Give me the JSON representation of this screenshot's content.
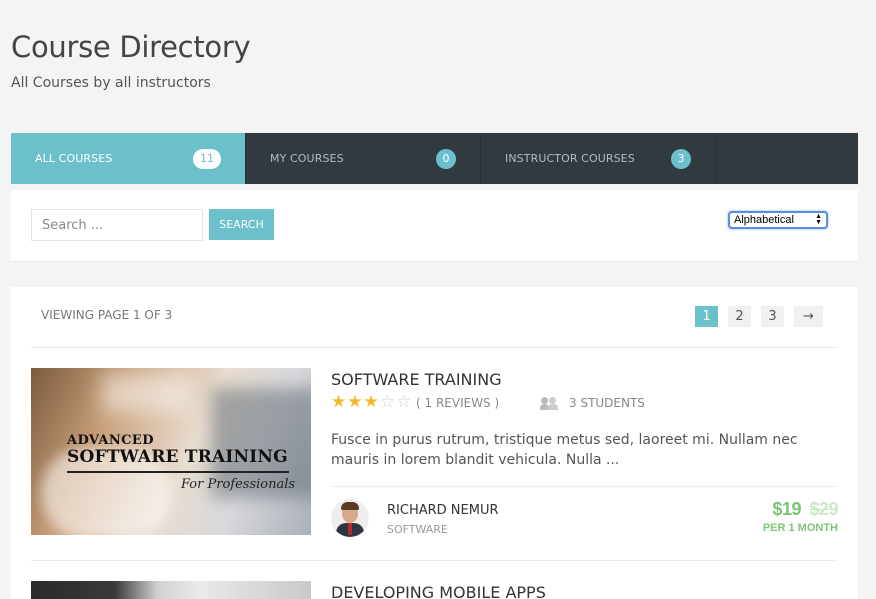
{
  "header": {
    "title": "Course Directory",
    "subtitle": "All Courses by all instructors"
  },
  "tabs": [
    {
      "label": "All Courses",
      "count": "11",
      "active": true
    },
    {
      "label": "My Courses",
      "count": "0",
      "active": false
    },
    {
      "label": "Instructor Courses",
      "count": "3",
      "active": false
    }
  ],
  "search": {
    "placeholder": "Search ...",
    "value": "",
    "button_label": "Search",
    "sort_selected": "Alphabetical"
  },
  "listing": {
    "viewing_text": "Viewing page 1 of 3",
    "pages": [
      "1",
      "2",
      "3"
    ],
    "current_page": "1",
    "next_label": "→"
  },
  "courses": [
    {
      "title": "Software Training",
      "rating": 3,
      "rating_max": 5,
      "reviews": "( 1 Reviews )",
      "students": "3 Students",
      "description": "Fusce in purus rutrum, tristique metus sed, laoreet mi. Nullam nec mauris in lorem blandit vehicula. Nulla ...",
      "thumbnail": {
        "line1": "ADVANCED",
        "line2": "SOFTWARE TRAINING",
        "line3": "For Professionals"
      },
      "instructor": {
        "name": "Richard Nemur",
        "category": "Software"
      },
      "price": {
        "current": "$19",
        "original": "$29",
        "period": "per 1 month"
      }
    },
    {
      "title": "Developing Mobile Apps"
    }
  ],
  "colors": {
    "accent": "#6cc0cc",
    "tabs_background": "#313a3f",
    "price": "#7cc576",
    "star": "#f1b82d"
  },
  "icons": {
    "students": "users-icon",
    "star_full": "star-icon",
    "star_empty": "star-outline-icon",
    "sort_arrows": "updown-arrows-icon"
  }
}
